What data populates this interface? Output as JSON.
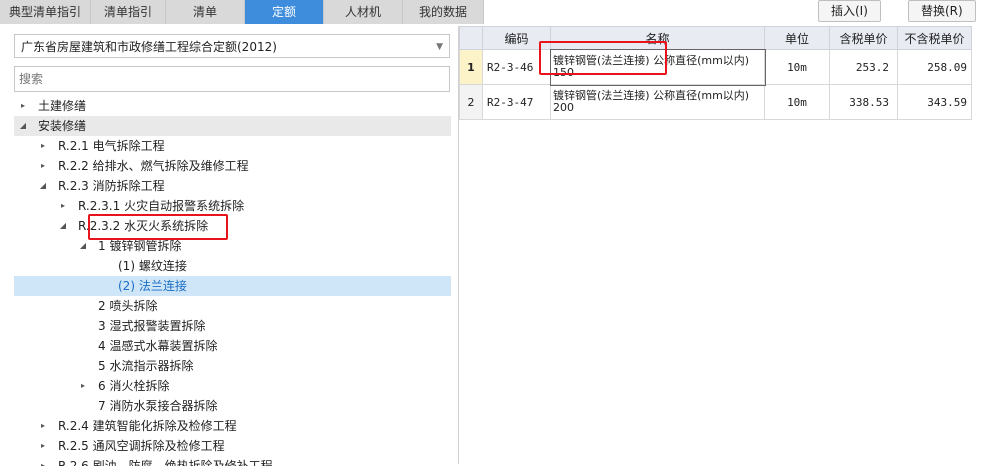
{
  "tabs": [
    {
      "label": "典型清单指引"
    },
    {
      "label": "清单指引"
    },
    {
      "label": "清单"
    },
    {
      "label": "定额"
    },
    {
      "label": "人材机"
    },
    {
      "label": "我的数据"
    }
  ],
  "buttons": {
    "insert": "插入(I)",
    "replace": "替换(R)"
  },
  "quota_library": {
    "selected": "广东省房屋建筑和市政修缮工程综合定额(2012)"
  },
  "search": {
    "placeholder": "搜索"
  },
  "tree": [
    {
      "label": "土建修缮",
      "toggle": "▸"
    },
    {
      "label": "安装修缮",
      "toggle": "◢"
    },
    {
      "label": "R.2.1 电气拆除工程",
      "toggle": "▸"
    },
    {
      "label": "R.2.2 给排水、燃气拆除及维修工程",
      "toggle": "▸"
    },
    {
      "label": "R.2.3 消防拆除工程",
      "toggle": "◢"
    },
    {
      "label": "R.2.3.1 火灾自动报警系统拆除",
      "toggle": "▸"
    },
    {
      "label": "R.2.3.2 水灭火系统拆除",
      "toggle": "◢"
    },
    {
      "label": "1 镀锌钢管拆除",
      "toggle": "◢"
    },
    {
      "label": "(1) 螺纹连接",
      "toggle": ""
    },
    {
      "label": "(2) 法兰连接",
      "toggle": ""
    },
    {
      "label": "2 喷头拆除",
      "toggle": ""
    },
    {
      "label": "3 湿式报警装置拆除",
      "toggle": ""
    },
    {
      "label": "4 温感式水幕装置拆除",
      "toggle": ""
    },
    {
      "label": "5 水流指示器拆除",
      "toggle": ""
    },
    {
      "label": "6 消火栓拆除",
      "toggle": "▸"
    },
    {
      "label": "7 消防水泵接合器拆除",
      "toggle": ""
    },
    {
      "label": "R.2.4 建筑智能化拆除及检修工程",
      "toggle": "▸"
    },
    {
      "label": "R.2.5 通风空调拆除及检修工程",
      "toggle": "▸"
    },
    {
      "label": "R.2.6 刷油、防腐、绝热拆除及修补工程",
      "toggle": "▸"
    }
  ],
  "grid": {
    "headers": {
      "code": "编码",
      "name": "名称",
      "unit": "单位",
      "tax_price": "含税单价",
      "notax_price": "不含税单价"
    },
    "rows": [
      {
        "idx": "1",
        "code": "R2-3-46",
        "name": "镀锌钢管(法兰连接) 公称直径(mm以内) 150",
        "unit": "10m",
        "tax_price": "253.2",
        "notax_price": "258.09"
      },
      {
        "idx": "2",
        "code": "R2-3-47",
        "name": "镀锌钢管(法兰连接) 公称直径(mm以内) 200",
        "unit": "10m",
        "tax_price": "338.53",
        "notax_price": "343.59"
      }
    ]
  },
  "colors": {
    "tab_active": "#3d8ddc",
    "highlight": "#e8141b",
    "selected_row": "#cfe5f8"
  }
}
